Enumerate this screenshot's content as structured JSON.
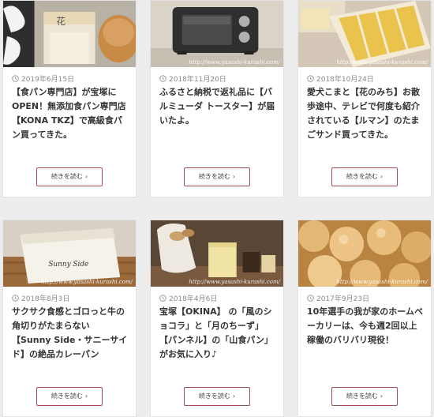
{
  "posts": [
    {
      "date": "2019年6月15日",
      "title": "【食パン専門店】が宝塚にOPEN！無添加食パン専門店【KONA TKZ】で高級食パン買ってきた。",
      "read_more": "続きを読む",
      "image": "bread-loaf-photo",
      "watermark": ""
    },
    {
      "date": "2018年11月20日",
      "title": "ふるさと納税で返礼品に【バルミューダ トースター】が届いたよ。",
      "read_more": "続きを読む",
      "image": "toaster-photo",
      "watermark": "http://www.yasashi-kurashi.com/"
    },
    {
      "date": "2018年10月24日",
      "title": "愛犬こまと【花のみち】お散歩途中、テレビで何度も紹介されている【ルマン】のたまごサンド買ってきた。",
      "read_more": "続きを読む",
      "image": "egg-sandwich-photo",
      "watermark": "http://www.yasashi-kurashi.com/"
    },
    {
      "date": "2018年8月3日",
      "title": "サクサク食感とゴロっと牛の角切りがたまらない【Sunny Side・サニーサイド】の絶品カレーパン",
      "read_more": "続きを読む",
      "image": "curry-bread-bag-photo",
      "watermark": "http://www.yasashi-kurashi.com/",
      "bag_text": "Sunny Side"
    },
    {
      "date": "2018年4月6日",
      "title": "宝塚【OKINA】 の「風のショコラ」と「月のちーず」【パンネル】の「山食パン」がお気に入り♪",
      "read_more": "続きを読む",
      "image": "sweets-and-bread-photo",
      "watermark": "http://www.yasashi-kurashi.com/"
    },
    {
      "date": "2017年9月23日",
      "title": "10年選手の我が家のホームベーカリーは、今も週2回以上稼働のバリバリ現役！",
      "read_more": "続きを読む",
      "image": "bread-rolls-photo",
      "watermark": "http://www.yasashi-kurashi.com/"
    }
  ],
  "colors": {
    "button_border": "#a34b54",
    "title": "#333333",
    "date": "#8a8a8a",
    "background": "#ededed"
  }
}
